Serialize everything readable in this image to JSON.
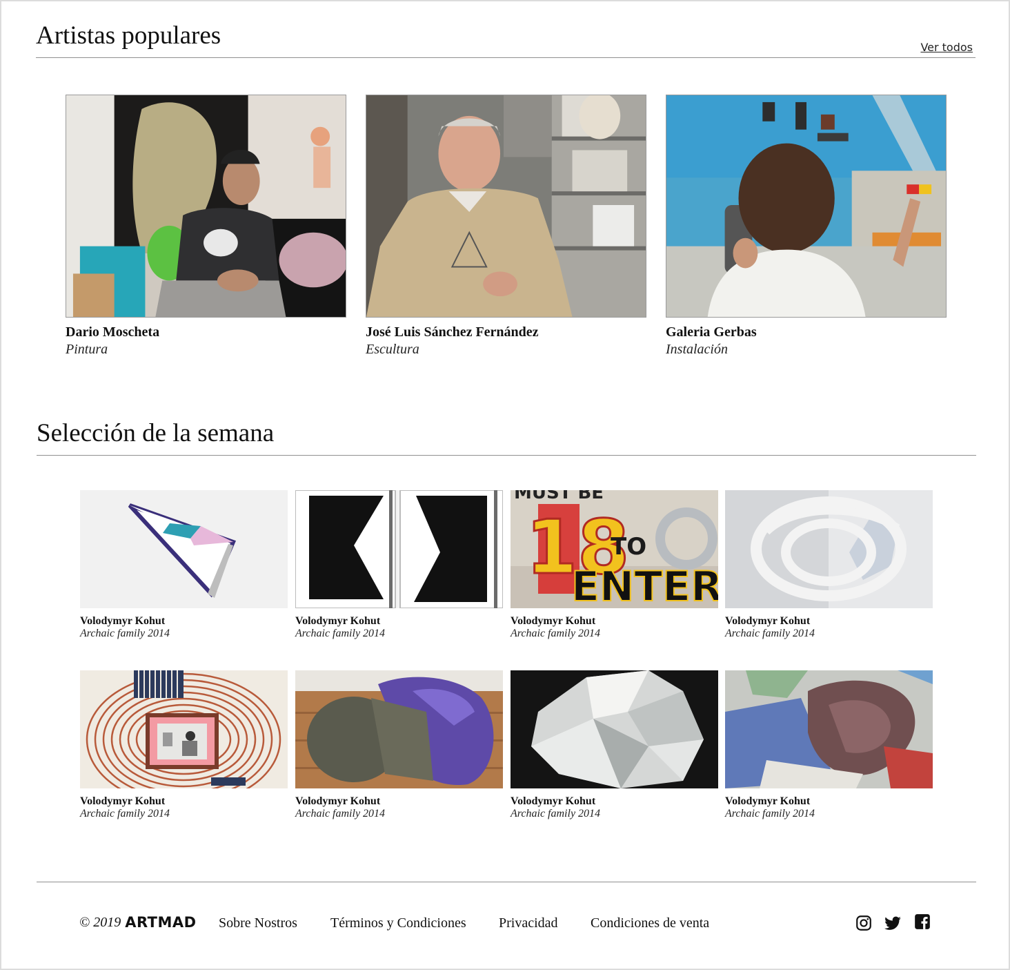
{
  "popular": {
    "title": "Artistas populares",
    "see_all": "Ver todos",
    "artists": [
      {
        "name": "Dario Moscheta",
        "category": "Pintura"
      },
      {
        "name": "José Luis Sánchez Fernández",
        "category": "Escultura"
      },
      {
        "name": "Galeria Gerbas",
        "category": "Instalación"
      }
    ]
  },
  "weekly": {
    "title": "Selección de la semana",
    "works": [
      {
        "artist": "Volodymyr Kohut",
        "title": "Archaic family 2014"
      },
      {
        "artist": "Volodymyr Kohut",
        "title": "Archaic family 2014"
      },
      {
        "artist": "Volodymyr Kohut",
        "title": "Archaic family 2014"
      },
      {
        "artist": "Volodymyr Kohut",
        "title": "Archaic family 2014"
      },
      {
        "artist": "Volodymyr Kohut",
        "title": "Archaic family 2014"
      },
      {
        "artist": "Volodymyr Kohut",
        "title": "Archaic family 2014"
      },
      {
        "artist": "Volodymyr Kohut",
        "title": "Archaic family 2014"
      },
      {
        "artist": "Volodymyr Kohut",
        "title": "Archaic family 2014"
      }
    ],
    "artwork_text": {
      "must_be": "MUST BE",
      "eighteen": "18",
      "to": "TO",
      "enter": "ENTER"
    }
  },
  "footer": {
    "copyright": "© 2019",
    "brand": "ARTMAD",
    "links": [
      "Sobre Nostros",
      "Términos y Condiciones",
      "Privacidad",
      "Condiciones de venta"
    ],
    "social_icons": [
      "instagram-icon",
      "twitter-icon",
      "facebook-icon"
    ]
  }
}
